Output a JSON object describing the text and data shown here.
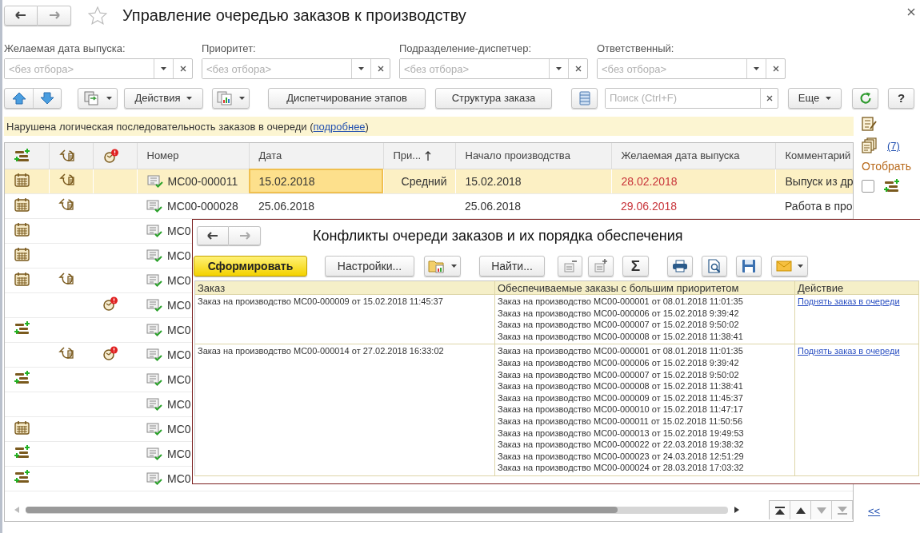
{
  "window": {
    "title": "Управление очередью заказов к производству"
  },
  "filters": [
    {
      "label": "Желаемая дата выпуска:",
      "placeholder": "<без отбора>"
    },
    {
      "label": "Приоритет:",
      "placeholder": "<без отбора>"
    },
    {
      "label": "Подразделение-диспетчер:",
      "placeholder": "<без отбора>"
    },
    {
      "label": "Ответственный:",
      "placeholder": "<без отбора>"
    }
  ],
  "toolbar": {
    "actions": "Действия",
    "dispatch": "Диспетчирование этапов",
    "structure": "Структура заказа",
    "search_placeholder": "Поиск (Ctrl+F)",
    "more": "Еще",
    "help": "?"
  },
  "warning": {
    "before": "Нарушена логическая последовательность заказов в очереди (",
    "link": "подробнее",
    "after": ")"
  },
  "table": {
    "columns": [
      {
        "label": "Номер",
        "sorted": false
      },
      {
        "label": "Дата",
        "sorted": false
      },
      {
        "label": "При...",
        "sorted": true
      },
      {
        "label": "Начало производства",
        "sorted": false
      },
      {
        "label": "Желаемая дата выпуска",
        "sorted": false
      },
      {
        "label": "Комментарий",
        "sorted": false
      }
    ],
    "rows": [
      {
        "selected": true,
        "kind": "calendar",
        "cycle": true,
        "alert": false,
        "number": "МС00-000011",
        "date": "15.02.2018",
        "date_focused": true,
        "priority": "Средний",
        "start": "15.02.2018",
        "desired": "28.02.2018",
        "overdue": true,
        "comment": "Выпуск из др"
      },
      {
        "selected": false,
        "kind": "calendar",
        "cycle": true,
        "alert": false,
        "number": "МС00-000028",
        "date": "25.06.2018",
        "start": "25.06.2018",
        "desired": "29.06.2018",
        "overdue": true,
        "comment": "Работа в про"
      },
      {
        "selected": false,
        "kind": "calendar",
        "cycle": false,
        "alert": false,
        "number": "МС0"
      },
      {
        "selected": false,
        "kind": "calendar",
        "cycle": false,
        "alert": false,
        "number": "МС0"
      },
      {
        "selected": false,
        "kind": "calendar",
        "cycle": true,
        "alert": false,
        "number": "МС0"
      },
      {
        "selected": false,
        "kind": "plain",
        "cycle": false,
        "alert": true,
        "number": "МС0"
      },
      {
        "selected": false,
        "kind": "transfer",
        "cycle": false,
        "alert": false,
        "number": "МС0"
      },
      {
        "selected": false,
        "kind": "plain",
        "cycle": true,
        "alert": true,
        "number": "МС0"
      },
      {
        "selected": false,
        "kind": "transfer",
        "cycle": false,
        "alert": false,
        "number": "МС0"
      },
      {
        "selected": false,
        "kind": "plain",
        "cycle": false,
        "alert": false,
        "number": "МС0"
      },
      {
        "selected": false,
        "kind": "calendar",
        "cycle": false,
        "alert": false,
        "number": "МС0"
      },
      {
        "selected": false,
        "kind": "transfer",
        "cycle": false,
        "alert": false,
        "number": "МС0"
      },
      {
        "selected": false,
        "kind": "transfer",
        "cycle": false,
        "alert": false,
        "number": "МС0"
      }
    ]
  },
  "side_panel": {
    "count_link": "(7)",
    "filter_label": "Отобрать",
    "filter_checked": false,
    "collapse_link": "<<"
  },
  "report": {
    "title": "Конфликты очереди заказов и их порядка обеспечения",
    "generate": "Сформировать",
    "settings": "Настройки...",
    "find": "Найти...",
    "sum": "Σ",
    "columns": [
      "Заказ",
      "Обеспечиваемые заказы с большим приоритетом",
      "Действие"
    ],
    "rows": [
      {
        "order": "Заказ на производство МС00-000009 от 15.02.2018 11:45:37",
        "provided": [
          "Заказ на производство МС00-000001 от 08.01.2018 11:01:35",
          "Заказ на производство МС00-000006 от 15.02.2018 9:39:42",
          "Заказ на производство МС00-000007 от 15.02.2018 9:50:02",
          "Заказ на производство МС00-000008 от 15.02.2018 11:38:41"
        ],
        "action": "Поднять заказ в очереди"
      },
      {
        "order": "Заказ на производство МС00-000014 от 27.02.2018 16:33:02",
        "provided": [
          "Заказ на производство МС00-000001 от 08.01.2018 11:01:35",
          "Заказ на производство МС00-000006 от 15.02.2018 9:39:42",
          "Заказ на производство МС00-000007 от 15.02.2018 9:50:02",
          "Заказ на производство МС00-000008 от 15.02.2018 11:38:41",
          "Заказ на производство МС00-000009 от 15.02.2018 11:45:37",
          "Заказ на производство МС00-000010 от 15.02.2018 11:47:17",
          "Заказ на производство МС00-000011 от 15.02.2018 11:50:56",
          "Заказ на производство МС00-000013 от 15.02.2018 19:49:53",
          "Заказ на производство МС00-000022 от 22.03.2018 19:38:32",
          "Заказ на производство МС00-000023 от 24.03.2018 12:51:29",
          "Заказ на производство МС00-000024 от 28.03.2018 17:03:32"
        ],
        "action": "Поднять заказ в очереди"
      }
    ]
  }
}
